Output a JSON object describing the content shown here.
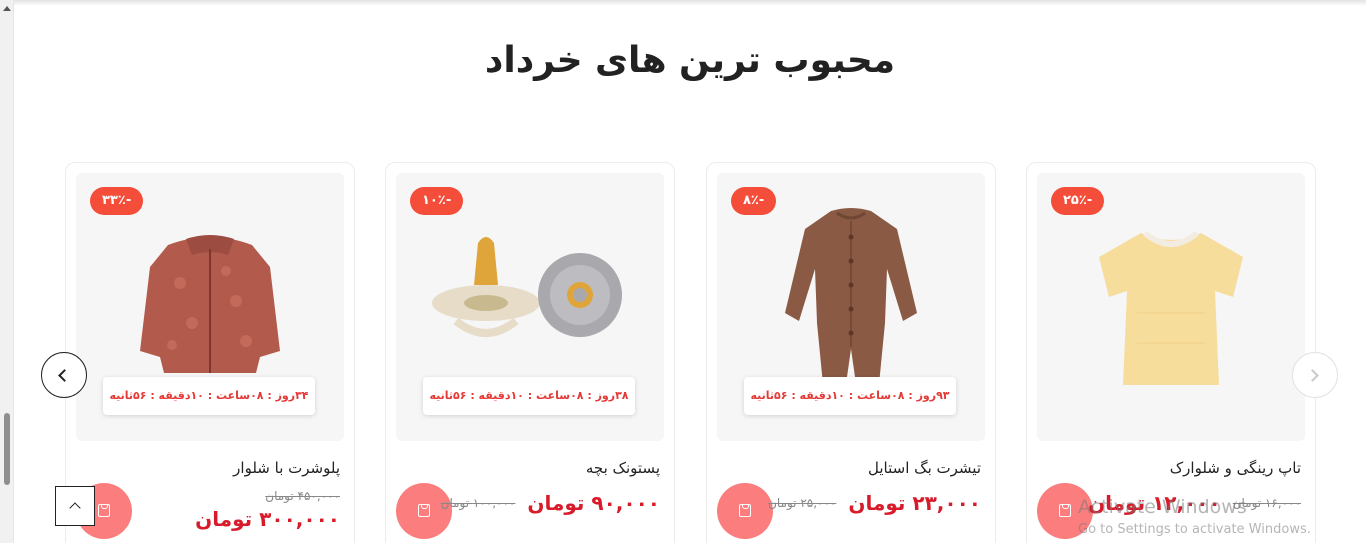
{
  "section": {
    "title": "محبوب ترین های خرداد"
  },
  "products": [
    {
      "name": "پلوشرت با شلوار",
      "discount": "-۳۳٪",
      "timer": "۳۴روز : ۰۸ساعت : ۱۰دقیقه : ۵۶ثانیه",
      "price": "۳۰۰,۰۰۰ تومان",
      "old_price": "۴۵۰,۰۰۰ تومان",
      "image": "fleece-jacket"
    },
    {
      "name": "پستونک بچه",
      "discount": "-۱۰٪",
      "timer": "۳۸روز : ۰۸ساعت : ۱۰دقیقه : ۵۶ثانیه",
      "price": "۹۰,۰۰۰ تومان",
      "old_price": "۱۰۰,۰۰۰ تومان",
      "image": "pacifiers"
    },
    {
      "name": "تیشرت بگ استایل",
      "discount": "-۸٪",
      "timer": "۹۳روز : ۰۸ساعت : ۱۰دقیقه : ۵۶ثانیه",
      "price": "۲۳,۰۰۰ تومان",
      "old_price": "۲۵,۰۰۰ تومان",
      "image": "baby-romper"
    },
    {
      "name": "تاپ رینگی و شلوارک",
      "discount": "-۲۵٪",
      "timer": "",
      "price": "۱۲,۰۰۰ تومان",
      "old_price": "۱۶,۰۰۰ تومان",
      "image": "yellow-tshirt"
    }
  ],
  "watermark": {
    "line1": "Activate Windows",
    "line2": "Go to Settings to activate Windows."
  },
  "colors": {
    "accent": "#f44e3b",
    "price": "#d81b2a",
    "cart": "#fb7d7d",
    "timer_text": "#e53935"
  }
}
